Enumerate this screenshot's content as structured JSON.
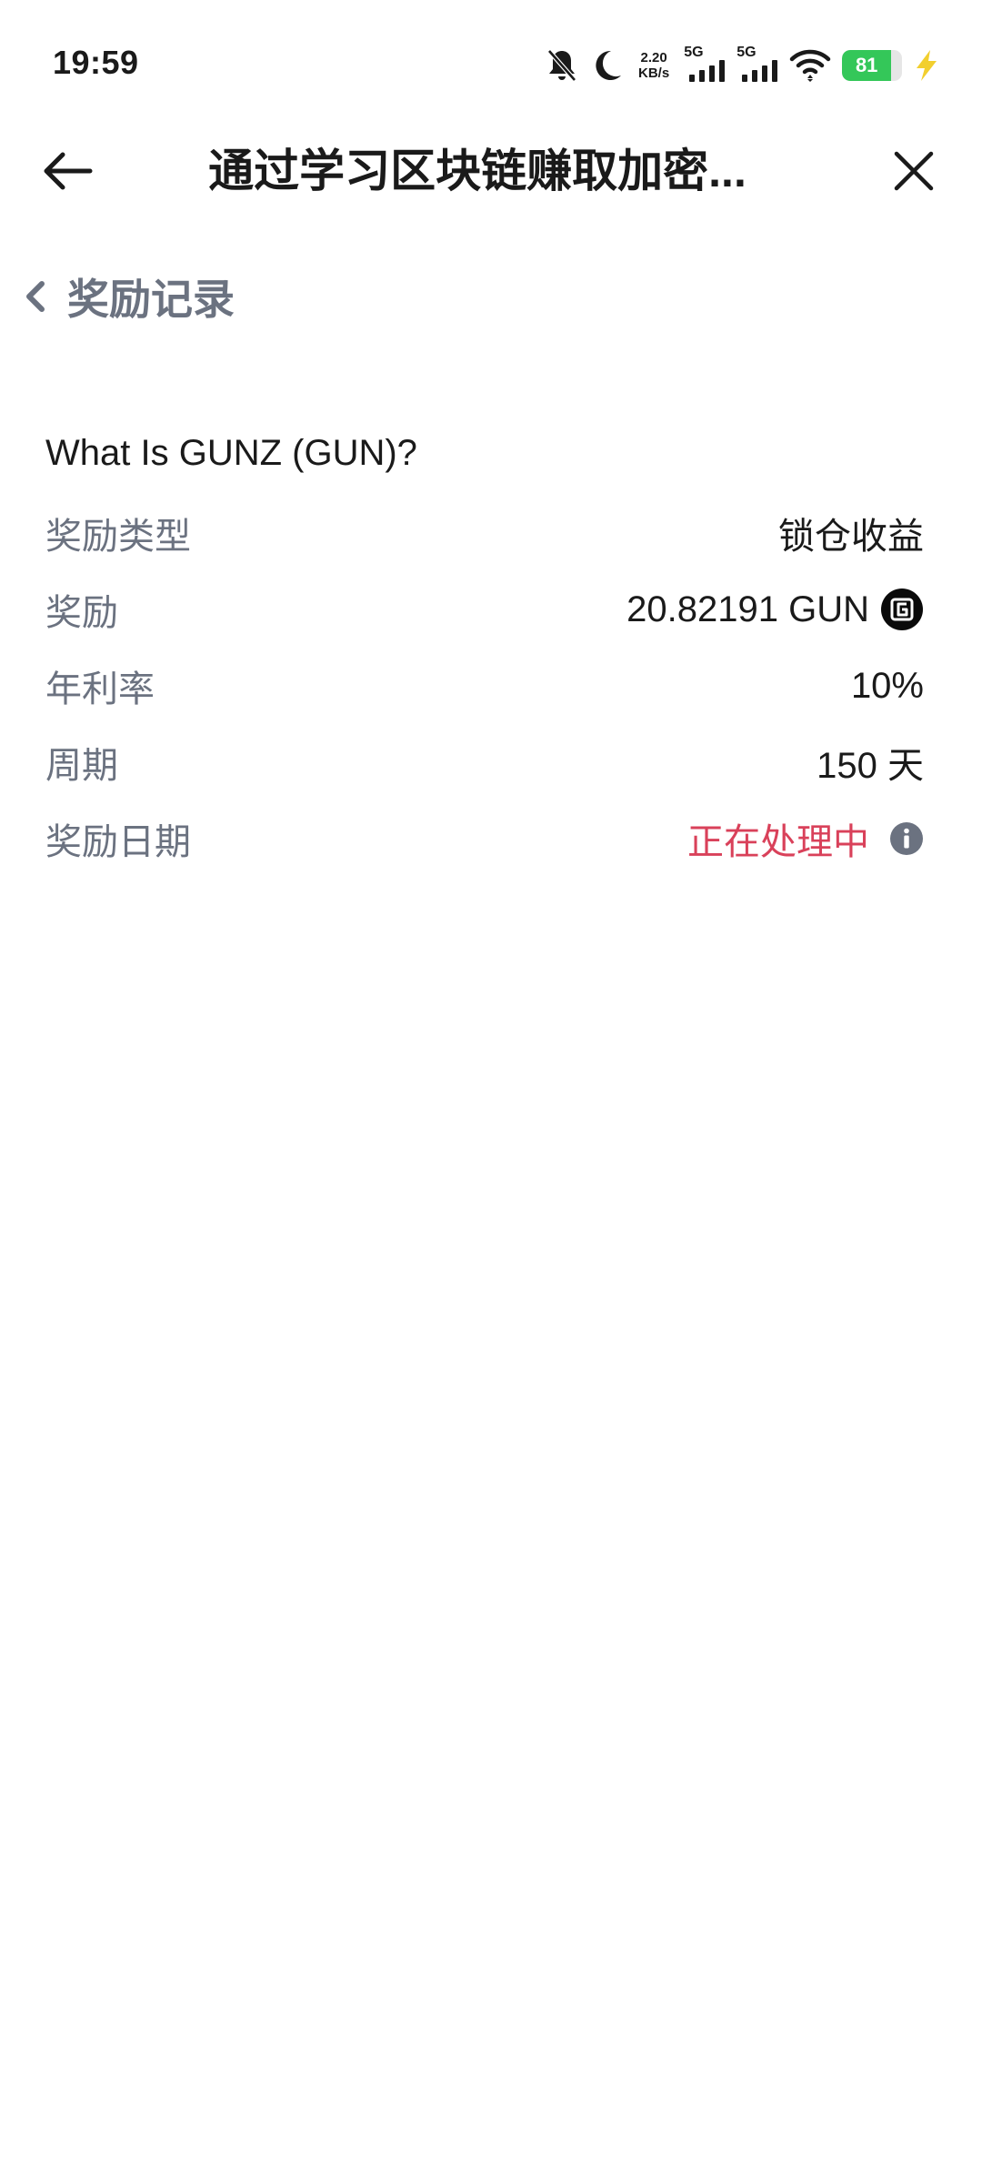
{
  "status_bar": {
    "time": "19:59",
    "net_speed_value": "2.20",
    "net_speed_unit": "KB/s",
    "signal_1_label": "5G",
    "signal_2_label": "5G",
    "battery_level": "81",
    "battery_fraction": 0.81,
    "icons": [
      "bell-muted-icon",
      "moon-icon",
      "signal-icon",
      "wifi-icon",
      "battery-icon",
      "charging-bolt-icon"
    ]
  },
  "header": {
    "title": "通过学习区块链赚取加密..."
  },
  "sub_header": {
    "title": "奖励记录"
  },
  "record": {
    "course_title": "What Is GUNZ (GUN)?",
    "rows": [
      {
        "label": "奖励类型",
        "value": "锁仓收益"
      },
      {
        "label": "奖励",
        "value": "20.82191 GUN"
      },
      {
        "label": "年利率",
        "value": "10%"
      },
      {
        "label": "周期",
        "value": "150 天"
      },
      {
        "label": "奖励日期",
        "value": "正在处理中"
      }
    ],
    "status_color": "#d9415a"
  }
}
